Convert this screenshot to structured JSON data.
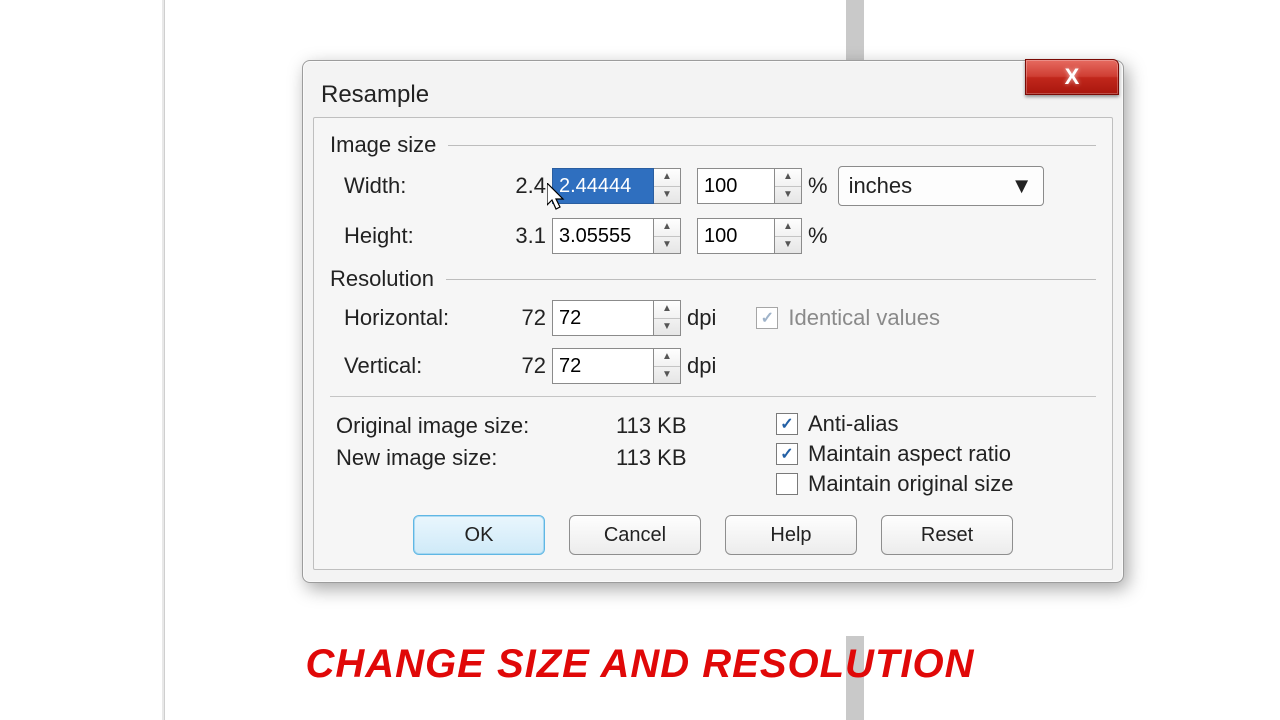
{
  "dialog": {
    "title": "Resample",
    "close_icon": "X"
  },
  "image_size": {
    "heading": "Image size",
    "width_label": "Width:",
    "height_label": "Height:",
    "width_hint": "2.4",
    "height_hint": "3.1",
    "width_value": "2.44444",
    "height_value": "3.05555",
    "width_pct": "100",
    "height_pct": "100",
    "pct_label": "%",
    "units_value": "inches"
  },
  "resolution": {
    "heading": "Resolution",
    "horiz_label": "Horizontal:",
    "vert_label": "Vertical:",
    "horiz_hint": "72",
    "vert_hint": "72",
    "horiz_value": "72",
    "vert_value": "72",
    "unit_label": "dpi",
    "identical_label": "Identical values",
    "identical_checked": true
  },
  "sizes": {
    "orig_label": "Original image size:",
    "orig_value": "113 KB",
    "new_label": "New image size:",
    "new_value": "113 KB"
  },
  "options": {
    "anti_alias_label": "Anti-alias",
    "anti_alias_checked": true,
    "aspect_label": "Maintain aspect ratio",
    "aspect_checked": true,
    "orig_size_label": "Maintain original size",
    "orig_size_checked": false
  },
  "buttons": {
    "ok": "OK",
    "cancel": "Cancel",
    "help": "Help",
    "reset": "Reset"
  },
  "caption": "CHANGE SIZE AND RESOLUTION"
}
